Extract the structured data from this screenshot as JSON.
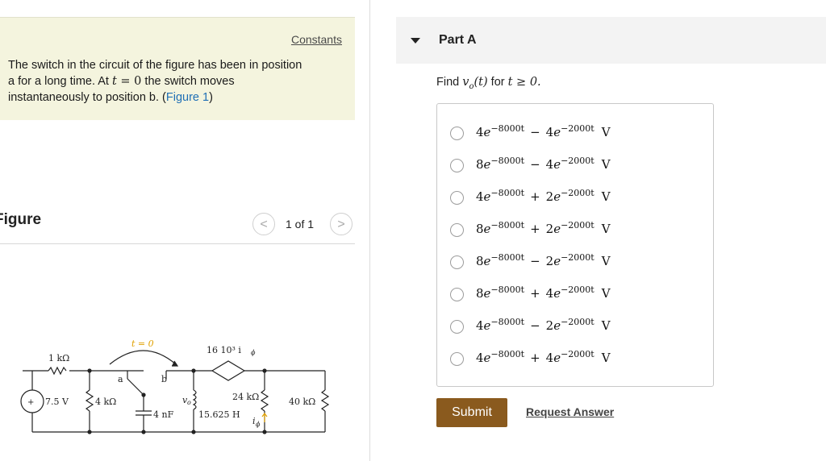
{
  "problem": {
    "constants_label": "Constants",
    "line1": "The switch in the circuit of the figure has been in position",
    "line2_pre": "a for a long time. At ",
    "line2_var": "t",
    "line2_eq": " = 0",
    "line2_post": " the switch moves",
    "line3_pre": "instantaneously to position b. (",
    "figure_link": "Figure 1",
    "line3_post": ")"
  },
  "figure": {
    "title": "Figure",
    "page_count": "1 of 1",
    "prev_icon": "<",
    "next_icon": ">",
    "circuit_labels": {
      "r1": "1 kΩ",
      "source": "7.5 V",
      "r2": "4 kΩ",
      "switch_time": "t = 0",
      "pos_a": "a",
      "pos_b": "b",
      "cap": "4 nF",
      "vo": "v",
      "vo_sub": "o",
      "dep_source": "16  10³ i",
      "dep_sub": "ϕ",
      "r3": "24 kΩ",
      "inductor": "15.625 H",
      "r4": "40 kΩ",
      "iphi": "i",
      "iphi_sub": "ϕ",
      "plus": "+",
      "minus": "−"
    }
  },
  "part": {
    "title": "Part A",
    "question_pre": "Find ",
    "question_expr": "v",
    "question_sub": "o",
    "question_arg": "(t)",
    "question_mid": " for ",
    "question_cond": "t ≥ 0."
  },
  "options": [
    {
      "c1": "4",
      "e1": "−8000t",
      "op": "−",
      "c2": "4",
      "e2": "−2000t",
      "unit": "V"
    },
    {
      "c1": "8",
      "e1": "−8000t",
      "op": "−",
      "c2": "4",
      "e2": "−2000t",
      "unit": "V"
    },
    {
      "c1": "4",
      "e1": "−8000t",
      "op": "+",
      "c2": "2",
      "e2": "−2000t",
      "unit": "V"
    },
    {
      "c1": "8",
      "e1": "−8000t",
      "op": "+",
      "c2": "2",
      "e2": "−2000t",
      "unit": "V"
    },
    {
      "c1": "8",
      "e1": "−8000t",
      "op": "−",
      "c2": "2",
      "e2": "−2000t",
      "unit": "V"
    },
    {
      "c1": "8",
      "e1": "−8000t",
      "op": "+",
      "c2": "4",
      "e2": "−2000t",
      "unit": "V"
    },
    {
      "c1": "4",
      "e1": "−8000t",
      "op": "−",
      "c2": "2",
      "e2": "−2000t",
      "unit": "V"
    },
    {
      "c1": "4",
      "e1": "−8000t",
      "op": "+",
      "c2": "4",
      "e2": "−2000t",
      "unit": "V"
    }
  ],
  "actions": {
    "submit_label": "Submit",
    "request_label": "Request Answer"
  },
  "colors": {
    "submit_bg": "#8a5a1e",
    "link_blue": "#1f6fb5",
    "problem_bg": "#f4f4de"
  }
}
